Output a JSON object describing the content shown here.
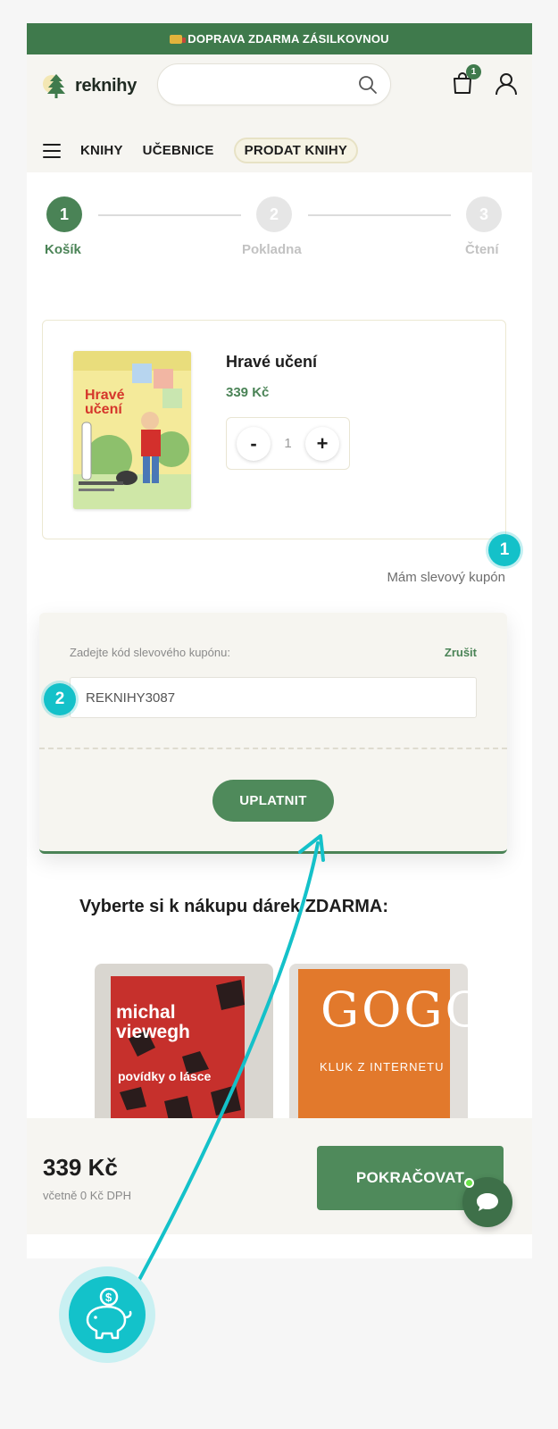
{
  "banner": {
    "text": "DOPRAVA ZDARMA ZÁSILKOVNOU"
  },
  "header": {
    "logo_text": "reknihy",
    "search_placeholder": "",
    "cart_count": "1"
  },
  "nav": {
    "items": [
      "KNIHY",
      "UČEBNICE",
      "PRODAT KNIHY"
    ]
  },
  "stepper": {
    "steps": [
      {
        "number": "1",
        "label": "Košík"
      },
      {
        "number": "2",
        "label": "Pokladna"
      },
      {
        "number": "3",
        "label": "Čtení"
      }
    ],
    "active_step": 1
  },
  "cart": {
    "product": {
      "title": "Hravé učení",
      "price": "339 Kč",
      "quantity": "1",
      "minus_label": "-",
      "plus_label": "+",
      "cover_title": "Hravé učení"
    }
  },
  "coupon": {
    "link_text": "Mám slevový kupón",
    "input_label": "Zadejte kód slevového kupónu:",
    "cancel_label": "Zrušit",
    "input_value": "REKNIHY3087",
    "apply_label": "UPLATNIT"
  },
  "gifts": {
    "heading": "Vyberte si k nákupu dárek ZDARMA:",
    "items": [
      {
        "author": "michal viewegh",
        "title": "povídky o lásce"
      },
      {
        "title": "GOGO",
        "subtitle": "KLUK Z INTERNETU"
      }
    ]
  },
  "footer": {
    "total": "339 Kč",
    "vat_note": "včetně 0 Kč DPH",
    "continue_label": "POKRAČOVAT"
  },
  "annotations": {
    "marker_1": "1",
    "marker_2": "2"
  },
  "colors": {
    "brand_green": "#4a8356",
    "banner_green": "#3f7a4c",
    "annotation_teal": "#14c1c9"
  },
  "icons": [
    "truck-icon",
    "logo-tree-icon",
    "search-icon",
    "cart-icon",
    "user-icon",
    "menu-icon",
    "chat-icon",
    "piggy-bank-icon"
  ]
}
